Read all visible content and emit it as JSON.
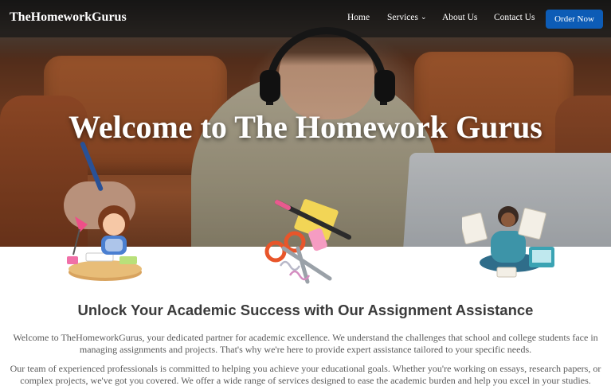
{
  "nav": {
    "logo": "TheHomeworkGurus",
    "links": {
      "home": "Home",
      "services": "Services",
      "about": "About Us",
      "contact": "Contact Us"
    },
    "services_chevron": "chevron-down-icon",
    "cta": "Order Now"
  },
  "hero": {
    "title": "Welcome to The Homework Gurus"
  },
  "content": {
    "heading": "Unlock Your Academic Success with Our Assignment Assistance",
    "paragraph_1": "Welcome to TheHomeworkGurus, your dedicated partner for academic excellence. We understand the challenges that school and college students face in managing assignments and projects. That's why we're here to provide expert assistance tailored to your specific needs.",
    "paragraph_2": "Our team of experienced professionals is committed to helping you achieve your educational goals. Whether you're working on essays, research papers, or complex projects, we've got you covered. We offer a wide range of services designed to ease the academic burden and help you excel in your studies."
  },
  "colors": {
    "nav_bg": "#161616",
    "cta": "#0d5cb6",
    "heading": "#3b3b3b",
    "body_text": "#5a5a5a"
  },
  "icons": [
    "chevron-down-icon",
    "girl-studying-illustration",
    "stationery-illustration",
    "student-reading-illustration"
  ]
}
